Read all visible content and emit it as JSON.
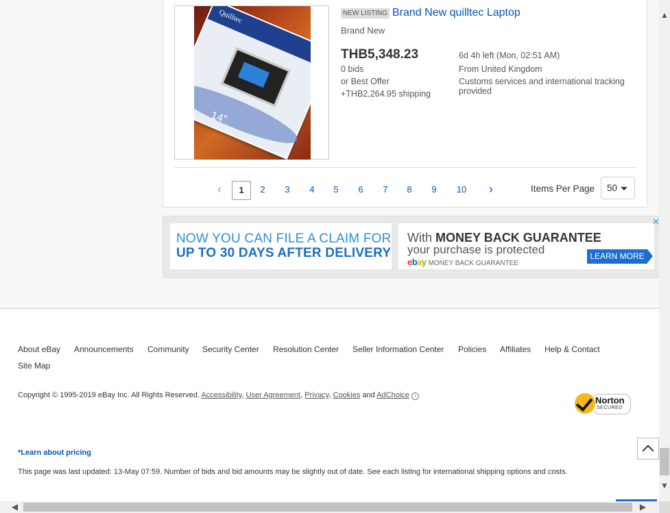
{
  "listing": {
    "badge": "NEW LISTING",
    "title": "Brand New quilltec Laptop",
    "condition": "Brand New",
    "price": "THB5,348.23",
    "bids": "0 bids",
    "best_offer": "or Best Offer",
    "shipping": "+THB2,264.95 shipping",
    "time_left": "6d 4h left (Mon, 02:51 AM)",
    "location": "From United Kingdom",
    "customs": "Customs services and international tracking provided",
    "image_brand_text": "Quilltec",
    "image_size_text": "14\""
  },
  "pagination": {
    "prev_icon": "chevron-left-icon",
    "next_icon": "chevron-right-icon",
    "pages": [
      "1",
      "2",
      "3",
      "4",
      "5",
      "6",
      "7",
      "8",
      "9",
      "10"
    ],
    "current_page": "1",
    "items_per_page_label": "Items Per Page",
    "items_per_page_value": "50"
  },
  "ad": {
    "left_line1": "NOW YOU CAN FILE A CLAIM FOR",
    "left_line2": "UP TO 30 DAYS AFTER DELIVERY",
    "right_prefix": "With ",
    "right_bold": "MONEY BACK GUARANTEE",
    "right_line2": "your purchase is protected",
    "right_logo": "ebay",
    "right_sub": "MONEY BACK GUARANTEE",
    "learn_more": "LEARN MORE",
    "close_mark": "✕"
  },
  "footer": {
    "links": [
      "About eBay",
      "Announcements",
      "Community",
      "Security Center",
      "Resolution Center",
      "Seller Information Center",
      "Policies",
      "Affiliates",
      "Help & Contact"
    ],
    "site_map": "Site Map",
    "copyright_text": "Copyright © 1995-2019 eBay Inc. All Rights Reserved.",
    "legal_links": [
      "Accessibility",
      "User Agreement",
      "Privacy",
      "Cookies"
    ],
    "and_text": "and",
    "adchoice": "AdChoice",
    "norton_name": "Norton",
    "norton_sub": "SECURED",
    "learn_pricing": "*Learn about pricing",
    "last_updated": "This page was last updated: 13-May 07:59. Number of bids and bid amounts may be slightly out of date. See each listing for international shipping options and costs."
  },
  "scrollbars": {
    "up": "▲",
    "down": "▼",
    "left": "◀",
    "right": "▶"
  },
  "colors": {
    "link": "#0654ba",
    "ad_blue": "#2c8fd6",
    "learn_more_bg": "#1c6fd0",
    "norton_yellow": "#f3b91c"
  }
}
